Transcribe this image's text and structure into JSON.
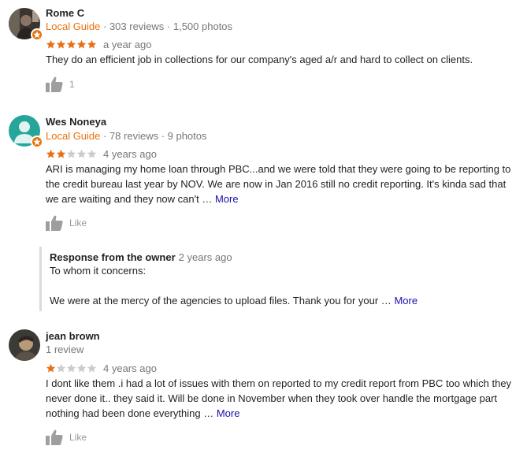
{
  "colors": {
    "star_filled": "#e7711b",
    "star_empty": "#cccccc",
    "local_guide": "#e8710a",
    "more_link": "#1a0dab",
    "secondary_text": "#777777"
  },
  "reviews": [
    {
      "name": "Rome C",
      "local_guide": "Local Guide",
      "stats": " · 303 reviews · 1,500 photos",
      "rating": 5,
      "time": "a year ago",
      "text": "They do an efficient job in collections for our company's aged a/r and hard to collect on clients.",
      "more": "",
      "like_label": "1",
      "avatar_icon": "profile-photo"
    },
    {
      "name": "Wes Noneya",
      "local_guide": "Local Guide",
      "stats": " · 78 reviews · 9 photos",
      "rating": 2,
      "time": "4 years ago",
      "text": "ARI is managing my home loan through PBC...and we were told that they were going to be reporting to the credit bureau last year by NOV. We are now in Jan 2016 still no credit reporting. It's kinda sad that we are waiting and they now can't …",
      "more": "More",
      "like_label": "Like",
      "avatar_icon": "default-person-avatar",
      "owner_response": {
        "title": "Response from the owner",
        "time": "2 years ago",
        "line1": "To whom it concerns:",
        "line2": "We were at the mercy of the agencies to upload files. Thank you for your …",
        "more": "More"
      }
    },
    {
      "name": "jean brown",
      "local_guide": "",
      "stats": "1 review",
      "rating": 1,
      "time": "4 years ago",
      "text": "I dont like them .i had a lot of issues with them on reported to my credit report from PBC too which they never done it.. they said it. Will be done in November when they  took over handle the mortgage part nothing had been done everything …",
      "more": "More",
      "like_label": "Like",
      "avatar_icon": "profile-photo"
    }
  ]
}
